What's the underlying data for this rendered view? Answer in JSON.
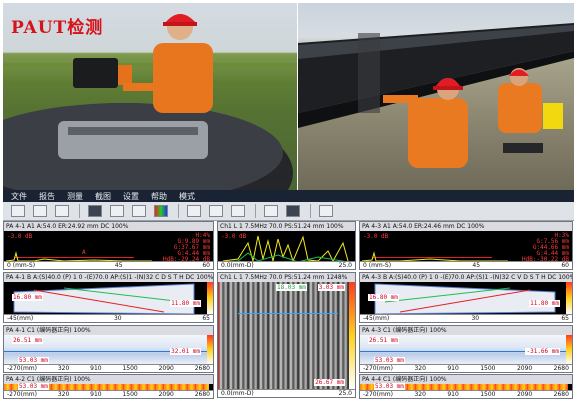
{
  "header": {
    "title": "PAUT检测"
  },
  "menu": {
    "items": [
      "文件",
      "报告",
      "测量",
      "截图",
      "设置",
      "帮助",
      "模式"
    ]
  },
  "colors": {
    "title_red": "#d6121b",
    "menubar": "#1a2333",
    "accent_red": "#d1001f",
    "trace_yellow": "#f3ea1a",
    "trace_green": "#19c24a"
  },
  "toolbar": {
    "icons": [
      "open-folder-icon",
      "save-icon",
      "save-as-icon",
      "screenshot-icon",
      "camera-icon",
      "report-icon",
      "palette-icon",
      "probe-icon",
      "layout-single-icon",
      "layout-split-icon",
      "layout-dual-icon",
      "layout-quad-icon",
      "cursor-icon"
    ]
  },
  "panels": {
    "p1": {
      "header": "PA 4-1 A1 A:54.0 ER:24.92 mm DC 100%",
      "top_left": "-3.0 dB",
      "top_right": "H:4%",
      "mid_left": "A",
      "r1": "G:9.89 mm",
      "r2": "G:37.67 mm",
      "r3": "G:4.44 mm",
      "r4": "HdB:-29.24 dB",
      "x_left": "0 (mm-S)",
      "x_mid": "45",
      "x_right": "60"
    },
    "p2": {
      "header": "Ch1 L 1 7.5MHz 70.0 PS:51.24 mm 100%",
      "top_left": "-3.0 dB",
      "x_left": "0.0(mm-D)",
      "x_right": "25.0"
    },
    "p3": {
      "header": "PA 4-3 A1 A:54.0 ER:24.46 mm DC 100%",
      "top_left": "-3.0 dB",
      "top_right": "H:3%",
      "r1": "G:7.56 mm",
      "r2": "G:44.66 mm",
      "r3": "G:4.44 mm",
      "r4": "HdB:-30.22 dB",
      "x_left": "0 (mm-S)",
      "x_mid": "45",
      "x_right": "60"
    },
    "p4": {
      "header": "PA 4-1 B A:(S)40.0 (P) 1 0 -(E)70.0 AP:(S)1 -(N)32 C D S T H DC 100%",
      "v1": "16.80 mm",
      "v2": "11.80 mm",
      "x_left": "-45(mm)",
      "x_mid": "30",
      "x_right": "65"
    },
    "p5": {
      "header": "Ch1 L 1 7.5MHz 70.0 PS:51.24 mm 1248%",
      "v1": "18.03 mm",
      "v2": "3.03 mm",
      "v3": "26.67 mm",
      "x_left": "0.0(mm-D)",
      "x_right": "25.0"
    },
    "p6": {
      "header": "PA 4-3 B A:(S)40.0 (P) 1 0 -(E)70.0 AP:(S)1 -(N)32 C V D S T H DC 100%",
      "v1": "16.80 mm",
      "v2": "11.80 mm",
      "x_left": "-45(mm)",
      "x_mid": "30",
      "x_right": "65"
    },
    "p7": {
      "header": "PA 4-1 C1 (编码器正向) 100%",
      "v1": "26.51 mm",
      "v2": "32.01 mm",
      "v3": "53.03 mm",
      "x": [
        "-270(mm)",
        "320",
        "910",
        "1500",
        "2090",
        "2680"
      ]
    },
    "p8": {
      "header": "PA 4-3 C1 (编码器正向) 100%",
      "v1": "26.51 mm",
      "v2": "-31.66 mm",
      "v3": "53.03 mm",
      "x": [
        "-270(mm)",
        "320",
        "910",
        "1500",
        "2090",
        "2680"
      ]
    },
    "p9": {
      "header": "PA 4-2 C1 (编码器正向) 100%",
      "v1": "53.03 mm",
      "x": [
        "-270(mm)",
        "320",
        "910",
        "1500",
        "2090",
        "2680"
      ]
    },
    "p10": {
      "header": "PA 4-4 C1 (编码器正向) 100%",
      "v1": "53.03 mm",
      "x": [
        "-270(mm)",
        "320",
        "910",
        "1500",
        "2090",
        "2680"
      ]
    }
  }
}
